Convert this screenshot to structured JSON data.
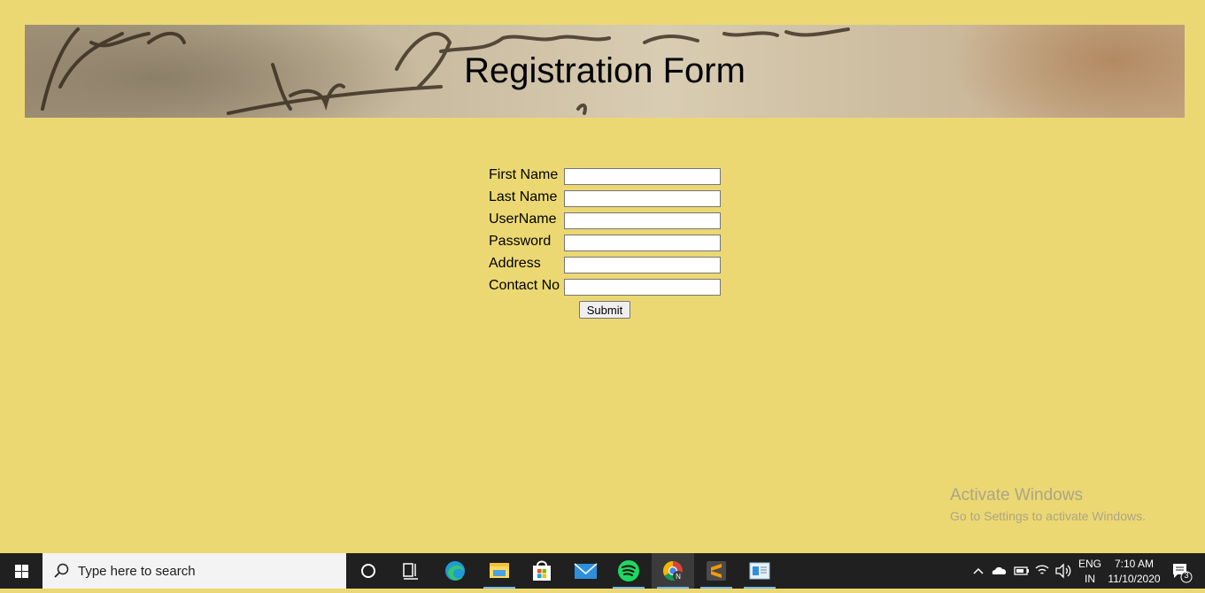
{
  "page": {
    "title": "Registration Form"
  },
  "form": {
    "fields": [
      {
        "label": "First Name",
        "value": ""
      },
      {
        "label": "Last Name",
        "value": ""
      },
      {
        "label": "UserName",
        "value": ""
      },
      {
        "label": "Password",
        "value": ""
      },
      {
        "label": "Address",
        "value": ""
      },
      {
        "label": "Contact No",
        "value": ""
      }
    ],
    "submit_label": "Submit"
  },
  "watermark": {
    "title": "Activate Windows",
    "subtitle": "Go to Settings to activate Windows."
  },
  "taskbar": {
    "search_placeholder": "Type here to search",
    "apps": [
      "task-view",
      "edge",
      "file-explorer",
      "microsoft-store",
      "mail",
      "spotify",
      "chrome",
      "sublime-text",
      "app-window"
    ],
    "language_line1": "ENG",
    "language_line2": "IN",
    "time": "7:10 AM",
    "date": "11/10/2020",
    "notification_count": "3"
  },
  "colors": {
    "background": "#ecd872",
    "taskbar": "#202020"
  }
}
